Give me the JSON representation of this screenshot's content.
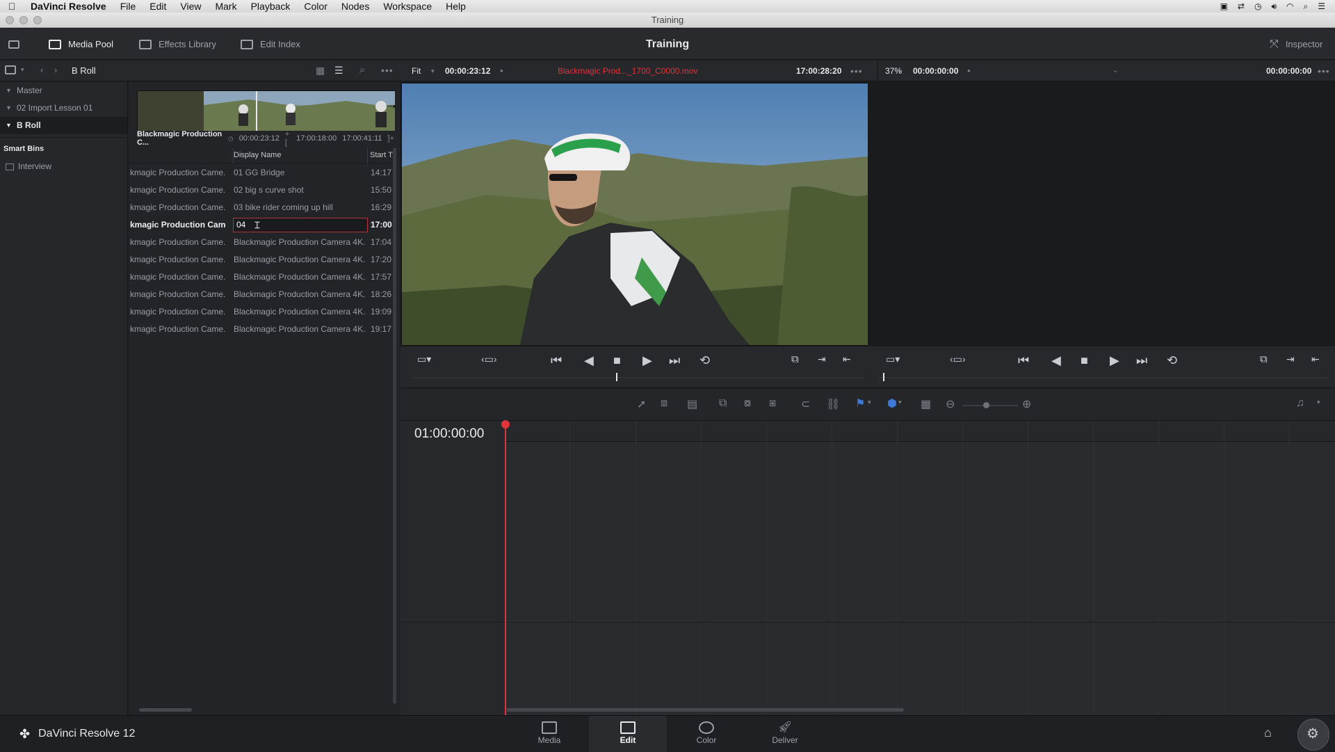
{
  "menubar": {
    "app_name": "DaVinci Resolve",
    "items": [
      "File",
      "Edit",
      "View",
      "Mark",
      "Playback",
      "Color",
      "Nodes",
      "Workspace",
      "Help"
    ]
  },
  "window": {
    "title": "Training"
  },
  "toolbar": {
    "media_pool": "Media Pool",
    "effects_library": "Effects Library",
    "edit_index": "Edit Index",
    "project_title": "Training",
    "inspector": "Inspector"
  },
  "binbar": {
    "current_bin": "B Roll"
  },
  "sidebar": {
    "bins": [
      {
        "label": "Master"
      },
      {
        "label": "02 Import Lesson 01"
      },
      {
        "label": "B Roll"
      }
    ],
    "smart_bins_heading": "Smart Bins",
    "smart_bins": [
      {
        "label": "Interview"
      }
    ]
  },
  "pool": {
    "thumb": {
      "name": "Blackmagic Production C...",
      "duration": "00:00:23:12",
      "in": "17:00:18:00",
      "out": "17:00:41:11"
    },
    "columns": [
      "Display Name",
      "Start T"
    ],
    "rows": [
      {
        "file": "kmagic Production Came...",
        "display": "01 GG Bridge",
        "start": "14:17"
      },
      {
        "file": "kmagic Production Came...",
        "display": "02 big s curve shot",
        "start": "15:50"
      },
      {
        "file": "kmagic Production Came...",
        "display": "03 bike rider coming up hill",
        "start": "16:29"
      },
      {
        "file": "kmagic Production Came...",
        "display": "04",
        "start": "17:00"
      },
      {
        "file": "kmagic Production Came...",
        "display": "Blackmagic Production Camera 4K...",
        "start": "17:04"
      },
      {
        "file": "kmagic Production Came...",
        "display": "Blackmagic Production Camera 4K...",
        "start": "17:20"
      },
      {
        "file": "kmagic Production Came...",
        "display": "Blackmagic Production Camera 4K...",
        "start": "17:57"
      },
      {
        "file": "kmagic Production Came...",
        "display": "Blackmagic Production Camera 4K...",
        "start": "18:26"
      },
      {
        "file": "kmagic Production Came...",
        "display": "Blackmagic Production Camera 4K...",
        "start": "19:09"
      },
      {
        "file": "kmagic Production Came...",
        "display": "Blackmagic Production Camera 4K...",
        "start": "19:17"
      }
    ]
  },
  "viewer": {
    "fit": "Fit",
    "source_duration": "00:00:23:12",
    "clip_name": "Blackmagic Prod..._1700_C0000.mov",
    "source_timecode": "17:00:28:20",
    "zoom": "37%",
    "timeline_timecode": "00:00:00:00",
    "timeline_timecode_right": "00:00:00:00"
  },
  "timeline": {
    "timecode": "01:00:00:00"
  },
  "pages": [
    {
      "label": "Media",
      "icon": "media-icon"
    },
    {
      "label": "Edit",
      "icon": "edit-icon"
    },
    {
      "label": "Color",
      "icon": "color-icon"
    },
    {
      "label": "Deliver",
      "icon": "deliver-icon"
    }
  ],
  "brand": {
    "label": "DaVinci Resolve 12"
  },
  "colors": {
    "accent_red": "#e0343a",
    "panel": "#26282c",
    "background": "#1e1f22"
  }
}
